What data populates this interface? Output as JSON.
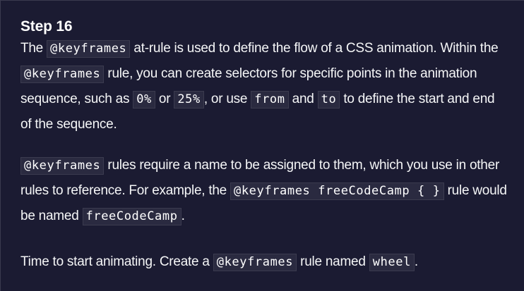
{
  "step": {
    "title": "Step 16"
  },
  "paragraphs": {
    "p1": {
      "t1": "The ",
      "c1": "@keyframes",
      "t2": " at-rule is used to define the flow of a CSS animation. Within the ",
      "c2": "@keyframes",
      "t3": " rule, you can create selectors for specific points in the animation sequence, such as ",
      "c3": "0%",
      "t4": " or ",
      "c4": "25%",
      "t5": ", or use ",
      "c5": "from",
      "t6": " and ",
      "c6": "to",
      "t7": " to define the start and end of the sequence."
    },
    "p2": {
      "c1": "@keyframes",
      "t1": " rules require a name to be assigned to them, which you use in other rules to reference. For example, the ",
      "c2": "@keyframes freeCodeCamp { }",
      "t2": " rule would be named ",
      "c3": "freeCodeCamp",
      "t3": "."
    },
    "p3": {
      "t1": "Time to start animating. Create a ",
      "c1": "@keyframes",
      "t2": " rule named ",
      "c2": "wheel",
      "t3": "."
    }
  }
}
